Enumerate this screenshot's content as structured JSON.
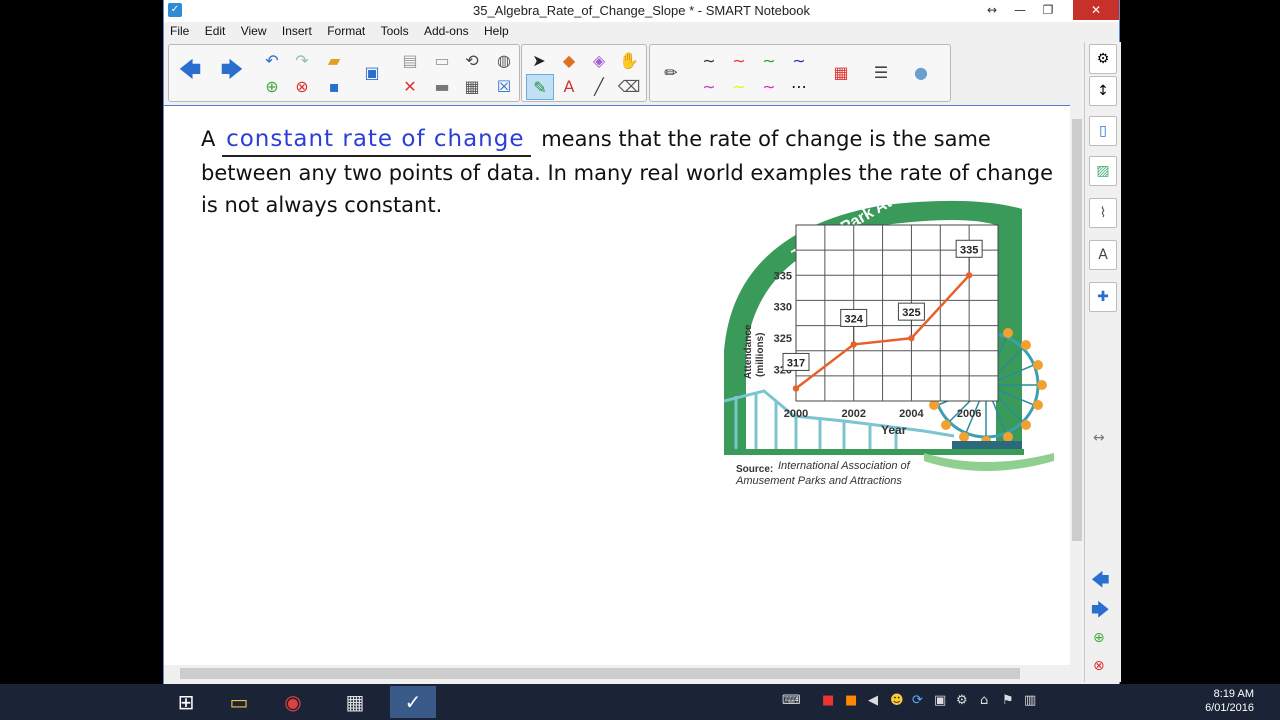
{
  "window": {
    "title": "35_Algebra_Rate_of_Change_Slope * - SMART Notebook",
    "app_icon": "smart-notebook-icon"
  },
  "menu": [
    "File",
    "Edit",
    "View",
    "Insert",
    "Format",
    "Tools",
    "Add-ons",
    "Help"
  ],
  "toolbar": {
    "icons": [
      "back-icon",
      "forward-icon",
      "undo-icon",
      "redo-icon",
      "open-icon",
      "screen-share-icon",
      "add-page-icon",
      "delete-page-icon",
      "save-icon",
      "paste-icon",
      "screen-shade-icon",
      "table-icon",
      "capture-icon",
      "close-icon",
      "select-icon",
      "shapes-icon",
      "eraser-icon",
      "fill-icon",
      "pen-icon",
      "text-icon",
      "line-icon",
      "creative-pen-icon",
      "color-icon",
      "line-style-icon",
      "transparency-icon"
    ]
  },
  "content": {
    "lead": "A",
    "handwritten": "constant  rate  of  change",
    "paragraph_rest": "means that the rate of change is the same between any two points of data.  In many real world examples the rate of change is not always constant."
  },
  "figure": {
    "banner": "Theme Park Attendance",
    "source_label": "Source:",
    "source_text": "International Association of Amusement Parks and Attractions",
    "yaxis_label_top": "Attendance",
    "yaxis_label_bottom": "(millions)",
    "xaxis_label": "Year",
    "colors": {
      "arch": "#3a9a5a",
      "line": "#e8602c",
      "coaster": "#7cc4cf"
    }
  },
  "chart_data": {
    "type": "line",
    "title": "Theme Park Attendance",
    "xlabel": "Year",
    "ylabel": "Attendance (millions)",
    "x": [
      2000,
      2002,
      2004,
      2006
    ],
    "y": [
      317,
      324,
      325,
      335
    ],
    "x_ticks": [
      "2000",
      "2002",
      "2004",
      "2006"
    ],
    "y_ticks": [
      "320",
      "325",
      "330",
      "335"
    ],
    "data_labels": [
      "317",
      "324",
      "325",
      "335"
    ],
    "ylim": [
      315,
      343
    ],
    "xlim": [
      2000,
      2007
    ],
    "grid": true
  },
  "taskbar": {
    "clock_time": "8:19 AM",
    "clock_date": "6/01/2016"
  }
}
